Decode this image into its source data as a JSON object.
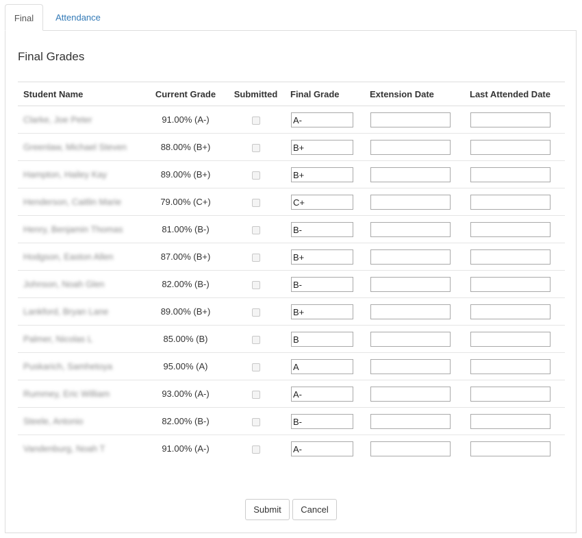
{
  "tabs": [
    {
      "label": "Final",
      "active": true
    },
    {
      "label": "Attendance",
      "active": false
    }
  ],
  "heading": "Final Grades",
  "columns": [
    "Student Name",
    "Current Grade",
    "Submitted",
    "Final Grade",
    "Extension Date",
    "Last Attended Date"
  ],
  "rows": [
    {
      "name": "Clarke, Joe Peter",
      "current_grade": "91.00% (A-)",
      "submitted": false,
      "final_grade": "A-",
      "extension_date": "",
      "last_attended_date": ""
    },
    {
      "name": "Greenlaw, Michael Steven",
      "current_grade": "88.00% (B+)",
      "submitted": false,
      "final_grade": "B+",
      "extension_date": "",
      "last_attended_date": ""
    },
    {
      "name": "Hampton, Hailey Kay",
      "current_grade": "89.00% (B+)",
      "submitted": false,
      "final_grade": "B+",
      "extension_date": "",
      "last_attended_date": ""
    },
    {
      "name": "Henderson, Caitlin Marie",
      "current_grade": "79.00% (C+)",
      "submitted": false,
      "final_grade": "C+",
      "extension_date": "",
      "last_attended_date": ""
    },
    {
      "name": "Henry, Benjamin Thomas",
      "current_grade": "81.00% (B-)",
      "submitted": false,
      "final_grade": "B-",
      "extension_date": "",
      "last_attended_date": ""
    },
    {
      "name": "Hodgson, Easton Allen",
      "current_grade": "87.00% (B+)",
      "submitted": false,
      "final_grade": "B+",
      "extension_date": "",
      "last_attended_date": ""
    },
    {
      "name": "Johnson, Noah Glen",
      "current_grade": "82.00% (B-)",
      "submitted": false,
      "final_grade": "B-",
      "extension_date": "",
      "last_attended_date": ""
    },
    {
      "name": "Lankford, Bryan Lane",
      "current_grade": "89.00% (B+)",
      "submitted": false,
      "final_grade": "B+",
      "extension_date": "",
      "last_attended_date": ""
    },
    {
      "name": "Palmer, Nicolas L",
      "current_grade": "85.00% (B)",
      "submitted": false,
      "final_grade": "B",
      "extension_date": "",
      "last_attended_date": ""
    },
    {
      "name": "Puskarich, Samhetoya",
      "current_grade": "95.00% (A)",
      "submitted": false,
      "final_grade": "A",
      "extension_date": "",
      "last_attended_date": ""
    },
    {
      "name": "Rummey, Eric William",
      "current_grade": "93.00% (A-)",
      "submitted": false,
      "final_grade": "A-",
      "extension_date": "",
      "last_attended_date": ""
    },
    {
      "name": "Steele, Antonio",
      "current_grade": "82.00% (B-)",
      "submitted": false,
      "final_grade": "B-",
      "extension_date": "",
      "last_attended_date": ""
    },
    {
      "name": "Vandenburg, Noah T",
      "current_grade": "91.00% (A-)",
      "submitted": false,
      "final_grade": "A-",
      "extension_date": "",
      "last_attended_date": ""
    }
  ],
  "buttons": {
    "submit": "Submit",
    "cancel": "Cancel"
  }
}
